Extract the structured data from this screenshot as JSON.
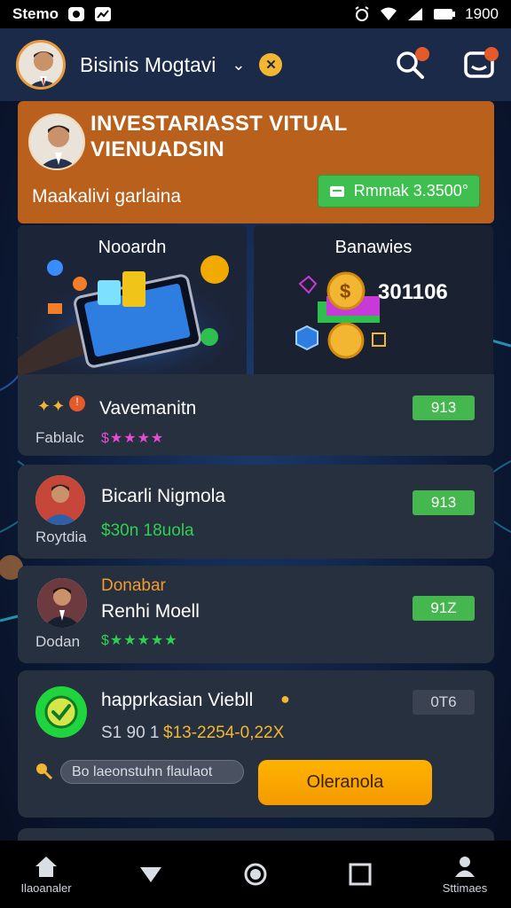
{
  "status_bar": {
    "carrier": "Stemo",
    "time": "1900"
  },
  "header": {
    "title": "Bisinis Mogtavi"
  },
  "banner": {
    "title": "INVESTARIASST VITUAL VIENUADSIN",
    "subtitle": "Maakalivi garlaina",
    "cta_label": "Rmmak 3.3500°"
  },
  "tiles": [
    {
      "title": "Nooardn"
    },
    {
      "title": "Banawies",
      "value": "301106"
    }
  ],
  "cards": [
    {
      "name": "Vavemanitn",
      "label": "Fablalc",
      "rating": "$★★★★",
      "badge": "913"
    },
    {
      "name": "Bicarli Nigmola",
      "label": "Roytdia",
      "detail": "$30n 18uola",
      "badge": "913"
    },
    {
      "category": "Donabar",
      "name": "Renhi Moell",
      "label": "Dodan",
      "rating": "$★★★★★",
      "badge": "91Z"
    },
    {
      "name": "happrkasian Viebll",
      "price": "S1 90 1",
      "detail": "$13-2254-0,22X",
      "badge": "0T6",
      "search_text": "Bo laeonstuhn flaulaot",
      "cta_label": "Oleranola"
    }
  ],
  "nav": [
    {
      "label": "Ilaoanaler",
      "icon": "home-icon"
    },
    {
      "label": "",
      "icon": "back-icon"
    },
    {
      "label": "",
      "icon": "home-circle-icon"
    },
    {
      "label": "",
      "icon": "recents-icon"
    },
    {
      "label": "Sttimaes",
      "icon": "profile-icon"
    }
  ],
  "colors": {
    "accent_orange": "#b8601c",
    "green": "#44b84e",
    "card_bg": "#27303f",
    "header_bg": "#1a2a48"
  }
}
